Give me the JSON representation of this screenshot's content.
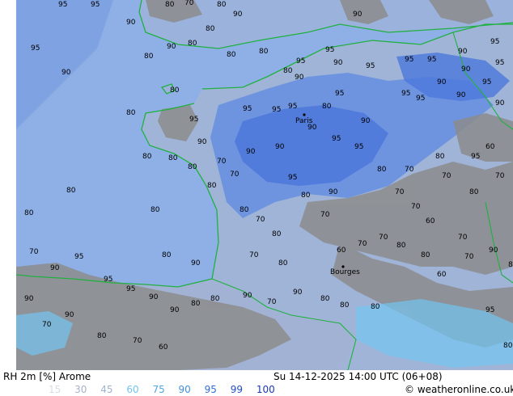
{
  "map": {
    "title": "RH 2m [%] Arome",
    "valid_time": "Su 14-12-2025 14:00 UTC (06+08)",
    "credit": "© weatheronline.co.uk",
    "city_labels": [
      "Paris",
      "Bourges"
    ],
    "contour_labels": [
      {
        "text": "95"
      },
      {
        "text": "95"
      },
      {
        "text": "80"
      },
      {
        "text": "70"
      },
      {
        "text": "80"
      },
      {
        "text": "90"
      },
      {
        "text": "80"
      },
      {
        "text": "90"
      },
      {
        "text": "95"
      },
      {
        "text": "90"
      },
      {
        "text": "90"
      },
      {
        "text": "80"
      },
      {
        "text": "80"
      },
      {
        "text": "95"
      },
      {
        "text": "90"
      },
      {
        "text": "80"
      },
      {
        "text": "80"
      },
      {
        "text": "90"
      },
      {
        "text": "80"
      },
      {
        "text": "90"
      },
      {
        "text": "95"
      },
      {
        "text": "95"
      },
      {
        "text": "95"
      },
      {
        "text": "95"
      },
      {
        "text": "90"
      },
      {
        "text": "95"
      },
      {
        "text": "95"
      },
      {
        "text": "90"
      },
      {
        "text": "95"
      },
      {
        "text": "95"
      },
      {
        "text": "90"
      },
      {
        "text": "90"
      },
      {
        "text": "95"
      },
      {
        "text": "90"
      },
      {
        "text": "80"
      },
      {
        "text": "80"
      },
      {
        "text": "95"
      },
      {
        "text": "90"
      },
      {
        "text": "95"
      },
      {
        "text": "95"
      },
      {
        "text": "95"
      },
      {
        "text": "80"
      },
      {
        "text": "95"
      },
      {
        "text": "90"
      },
      {
        "text": "90"
      },
      {
        "text": "90"
      },
      {
        "text": "95"
      },
      {
        "text": "95"
      },
      {
        "text": "80"
      },
      {
        "text": "80"
      },
      {
        "text": "80"
      },
      {
        "text": "80"
      },
      {
        "text": "80"
      },
      {
        "text": "70"
      },
      {
        "text": "90"
      },
      {
        "text": "70"
      },
      {
        "text": "95"
      },
      {
        "text": "90"
      },
      {
        "text": "80"
      },
      {
        "text": "70"
      },
      {
        "text": "80"
      },
      {
        "text": "95"
      },
      {
        "text": "60"
      },
      {
        "text": "70"
      },
      {
        "text": "80"
      },
      {
        "text": "70"
      },
      {
        "text": "70"
      },
      {
        "text": "70"
      },
      {
        "text": "80"
      },
      {
        "text": "70"
      },
      {
        "text": "60"
      },
      {
        "text": "70"
      },
      {
        "text": "80"
      },
      {
        "text": "80"
      },
      {
        "text": "80"
      },
      {
        "text": "70"
      },
      {
        "text": "80"
      },
      {
        "text": "60"
      },
      {
        "text": "70"
      },
      {
        "text": "70"
      },
      {
        "text": "80"
      },
      {
        "text": "80"
      },
      {
        "text": "70"
      },
      {
        "text": "80"
      },
      {
        "text": "90"
      },
      {
        "text": "70"
      },
      {
        "text": "80"
      },
      {
        "text": "90"
      },
      {
        "text": "95"
      },
      {
        "text": "95"
      },
      {
        "text": "95"
      },
      {
        "text": "90"
      },
      {
        "text": "90"
      },
      {
        "text": "80"
      },
      {
        "text": "80"
      },
      {
        "text": "90"
      },
      {
        "text": "70"
      },
      {
        "text": "90"
      },
      {
        "text": "80"
      },
      {
        "text": "80"
      },
      {
        "text": "80"
      },
      {
        "text": "60"
      },
      {
        "text": "70"
      },
      {
        "text": "90"
      },
      {
        "text": "80"
      },
      {
        "text": "90"
      },
      {
        "text": "70"
      },
      {
        "text": "90"
      },
      {
        "text": "80"
      },
      {
        "text": "70"
      },
      {
        "text": "60"
      },
      {
        "text": "95"
      },
      {
        "text": "80"
      }
    ]
  },
  "legend": {
    "items": [
      {
        "label": "15",
        "color": "#d8dce8"
      },
      {
        "label": "30",
        "color": "#a8b0c8"
      },
      {
        "label": "45",
        "color": "#9fb4d0"
      },
      {
        "label": "60",
        "color": "#74c4f0"
      },
      {
        "label": "75",
        "color": "#4ea8e0"
      },
      {
        "label": "90",
        "color": "#4090e0"
      },
      {
        "label": "95",
        "color": "#3070d8"
      },
      {
        "label": "99",
        "color": "#2050c8"
      },
      {
        "label": "100",
        "color": "#1838b8"
      }
    ]
  },
  "colors": {
    "sea": "#8fb0e6",
    "land_low": "#a0b4d8",
    "land_high_rh": "#6890e0",
    "land_very_high_rh": "#4c78dc",
    "gray_areas": "#8c8c8c",
    "coastline": "#20b040",
    "border": "#20b040"
  }
}
